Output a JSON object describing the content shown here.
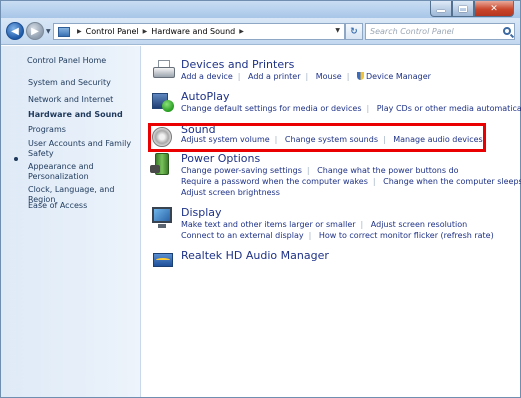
{
  "window": {
    "caption_buttons": [
      "minimize",
      "maximize",
      "close"
    ]
  },
  "navigation": {
    "breadcrumbs": [
      "Control Panel",
      "Hardware and Sound"
    ],
    "search_placeholder": "Search Control Panel"
  },
  "sidebar": {
    "items": [
      {
        "label": "Control Panel Home"
      },
      {
        "label": "System and Security"
      },
      {
        "label": "Network and Internet"
      },
      {
        "label": "Hardware and Sound",
        "current": true
      },
      {
        "label": "Programs"
      },
      {
        "label": "User Accounts and Family Safety"
      },
      {
        "label": "Appearance and Personalization"
      },
      {
        "label": "Clock, Language, and Region"
      },
      {
        "label": "Ease of Access"
      }
    ]
  },
  "categories": [
    {
      "title": "Devices and Printers",
      "icon": "printer-icon",
      "tasks": [
        [
          "Add a device",
          "Add a printer",
          "Mouse",
          "Device Manager"
        ]
      ]
    },
    {
      "title": "AutoPlay",
      "icon": "autoplay-icon",
      "tasks": [
        [
          "Change default settings for media or devices",
          "Play CDs or other media automatically"
        ]
      ]
    },
    {
      "title": "Sound",
      "icon": "speaker-icon",
      "tasks": [
        [
          "Adjust system volume",
          "Change system sounds",
          "Manage audio devices"
        ]
      ]
    },
    {
      "title": "Power Options",
      "icon": "battery-icon",
      "tasks": [
        [
          "Change power-saving settings",
          "Change what the power buttons do"
        ],
        [
          "Require a password when the computer wakes",
          "Change when the computer sleeps"
        ],
        [
          "Adjust screen brightness"
        ]
      ]
    },
    {
      "title": "Display",
      "icon": "monitor-icon",
      "tasks": [
        [
          "Make text and other items larger or smaller",
          "Adjust screen resolution"
        ],
        [
          "Connect to an external display",
          "How to correct monitor flicker (refresh rate)"
        ]
      ]
    },
    {
      "title": "Realtek HD Audio Manager",
      "icon": "realtek-audio-icon",
      "tasks": []
    }
  ],
  "highlight": {
    "color": "#ea0000",
    "target": "Sound"
  }
}
